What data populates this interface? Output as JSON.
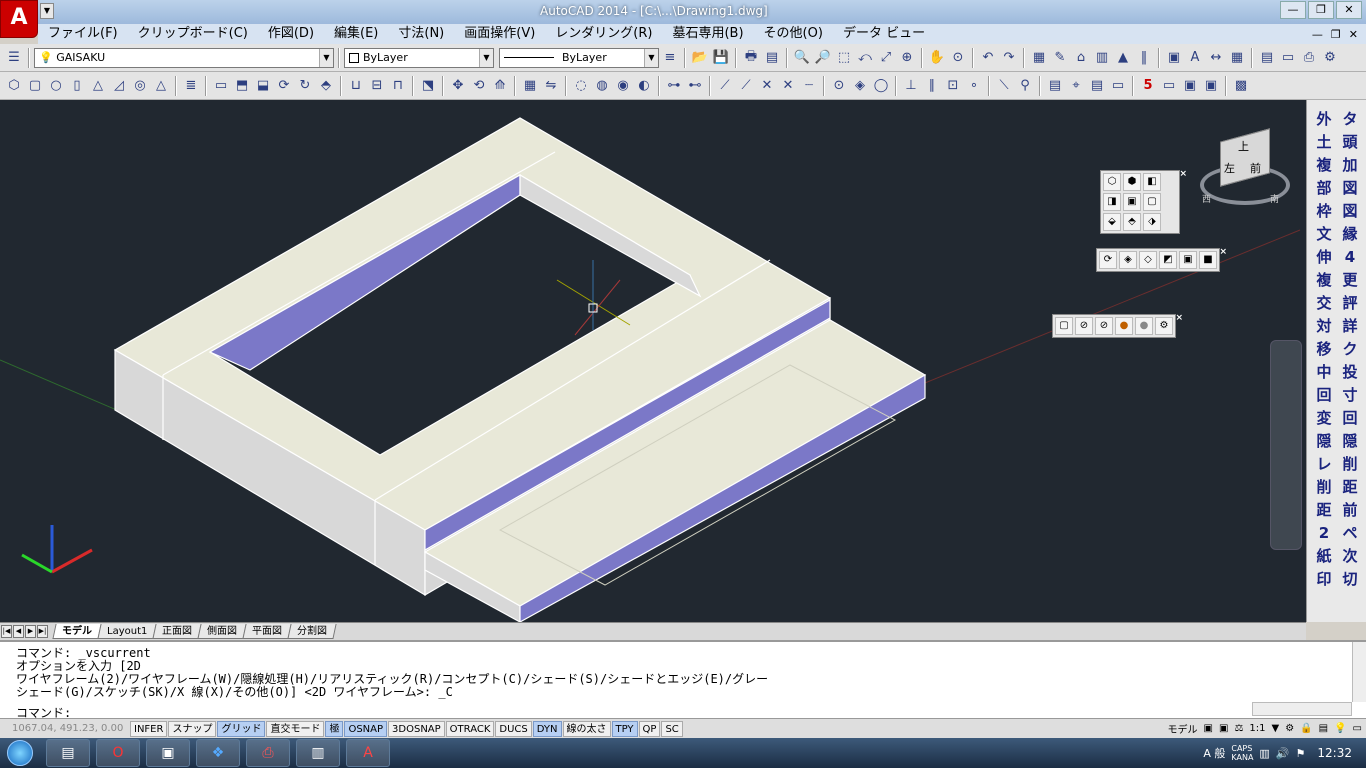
{
  "app": {
    "title": "AutoCAD 2014 - [C:\\...\\Drawing1.dwg]",
    "logo": "A"
  },
  "menu": {
    "items": [
      "ファイル(F)",
      "クリップボード(C)",
      "作図(D)",
      "編集(E)",
      "寸法(N)",
      "画面操作(V)",
      "レンダリング(R)",
      "墓石専用(B)",
      "その他(O)",
      "データ ビュー"
    ]
  },
  "toolbar1": {
    "layer": "GAISAKU",
    "color": "ByLayer",
    "linetype": "ByLayer"
  },
  "tabs": {
    "items": [
      "モデル",
      "Layout1",
      "正面図",
      "側面図",
      "平面図",
      "分割図"
    ],
    "active": 0
  },
  "command": {
    "line1": "コマンド: _vscurrent",
    "line2": "オプションを入力 [2D",
    "line3": "ワイヤフレーム(2)/ワイヤフレーム(W)/隠線処理(H)/リアリスティック(R)/コンセプト(C)/シェード(S)/シェードとエッジ(E)/グレー",
    "line4": "シェード(G)/スケッチ(SK)/X 線(X)/その他(O)] <2D ワイヤフレーム>: _C",
    "prompt": "コマンド:"
  },
  "status": {
    "coords": "1067.04, 491.23, 0.00",
    "buttons": [
      {
        "label": "INFER",
        "on": false
      },
      {
        "label": "スナップ",
        "on": false
      },
      {
        "label": "グリッド",
        "on": true
      },
      {
        "label": "直交モード",
        "on": false
      },
      {
        "label": "極",
        "on": true
      },
      {
        "label": "OSNAP",
        "on": true
      },
      {
        "label": "3DOSNAP",
        "on": false
      },
      {
        "label": "OTRACK",
        "on": false
      },
      {
        "label": "DUCS",
        "on": false
      },
      {
        "label": "DYN",
        "on": true
      },
      {
        "label": "線の太さ",
        "on": false
      },
      {
        "label": "TPY",
        "on": true
      },
      {
        "label": "QP",
        "on": false
      },
      {
        "label": "SC",
        "on": false
      }
    ],
    "model_label": "モデル",
    "scale": "1:1"
  },
  "viewcube": {
    "top_label": "上",
    "left_label": "左",
    "front_label": "前",
    "west": "西",
    "south": "南"
  },
  "rightpalette": {
    "col1": [
      "外",
      "土",
      "複",
      "部",
      "枠",
      "文",
      "伸",
      "複",
      "交",
      "対",
      "移",
      "中",
      "回",
      "変",
      "隠",
      "レ",
      "削",
      "距",
      "2",
      "紙",
      "印"
    ],
    "col2": [
      "タ",
      "頭",
      "加",
      "図",
      "図",
      "縁",
      "4",
      "更",
      "評",
      "詳",
      "ク",
      "投",
      "寸",
      "回",
      "隠",
      "削",
      "距",
      "前",
      "ペ",
      "次",
      "切"
    ]
  },
  "taskbar": {
    "ime": "A 般",
    "caps": "CAPS",
    "kana": "KANA",
    "clock": "12:32"
  },
  "colors": {
    "viewport_bg": "#212830",
    "stone_top": "#e8e8d8",
    "stone_side": "#d8d8d8",
    "stone_inner": "#7b78c8",
    "accent_red": "#c00000"
  }
}
